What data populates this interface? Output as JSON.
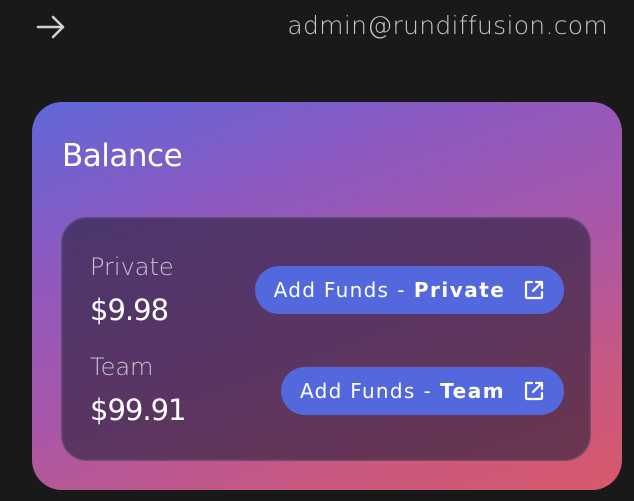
{
  "header": {
    "back_icon": "arrow-right-icon",
    "email": "admin@rundiffusion.com"
  },
  "balance_card": {
    "title": "Balance",
    "accounts": [
      {
        "label": "Private",
        "amount": "$9.98",
        "button": {
          "prefix": "Add Funds",
          "separator": "-",
          "account": "Private",
          "icon": "external-link-icon"
        }
      },
      {
        "label": "Team",
        "amount": "$99.91",
        "button": {
          "prefix": "Add Funds",
          "separator": "-",
          "account": "Team",
          "icon": "external-link-icon"
        }
      }
    ]
  },
  "colors": {
    "background": "#191919",
    "button": "#5468dd",
    "gradient_start": "#5f67d9",
    "gradient_end": "#d8596a"
  }
}
